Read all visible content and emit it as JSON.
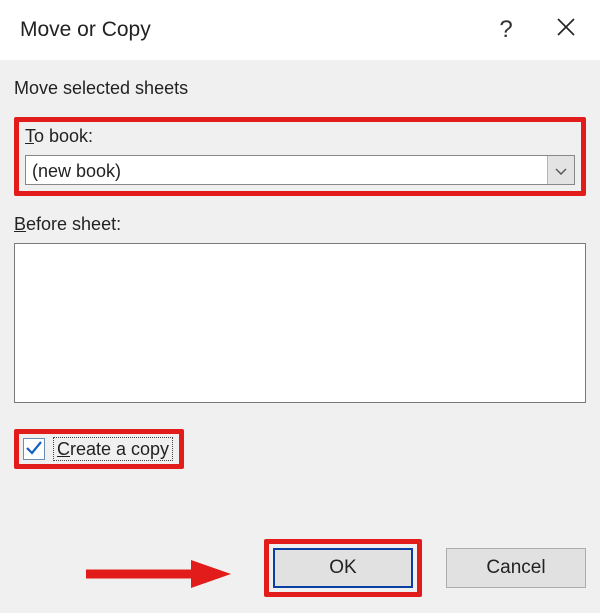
{
  "titlebar": {
    "title": "Move or Copy",
    "help_label": "?"
  },
  "content": {
    "subtitle": "Move selected sheets",
    "to_book": {
      "mnemonic": "T",
      "label_rest": "o book:",
      "value": "(new book)"
    },
    "before_sheet": {
      "mnemonic": "B",
      "label_rest": "efore sheet:"
    },
    "create_copy": {
      "mnemonic": "C",
      "label_rest": "reate a copy",
      "checked": true
    }
  },
  "buttons": {
    "ok": "OK",
    "cancel": "Cancel"
  }
}
